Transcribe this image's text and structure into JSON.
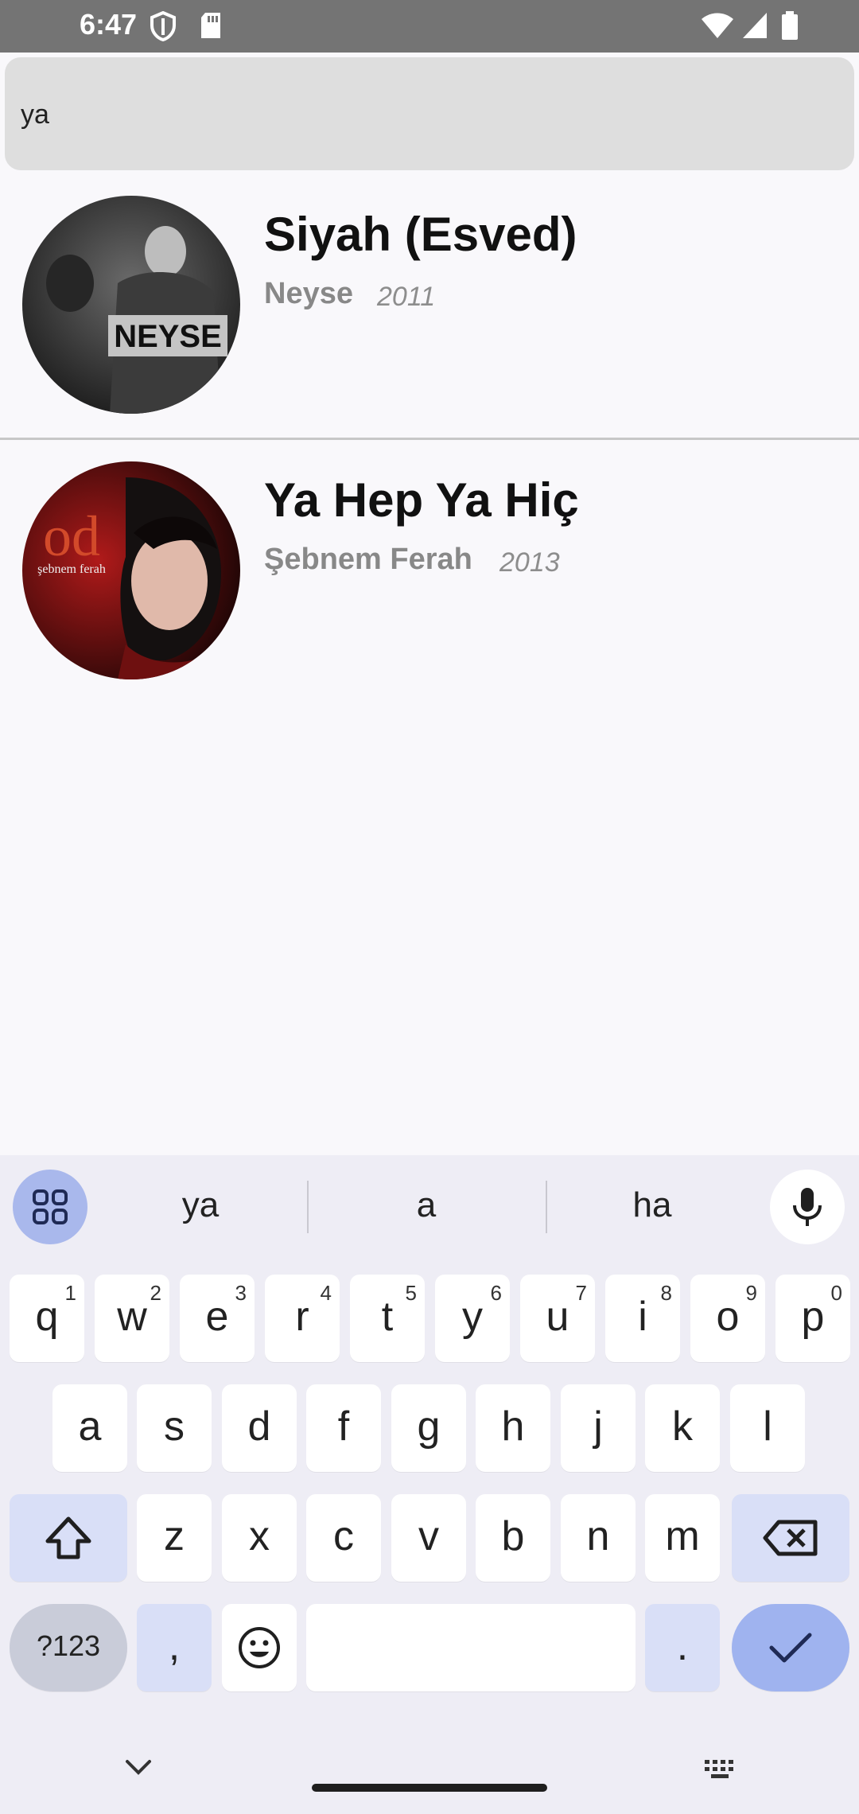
{
  "status_bar": {
    "time": "6:47"
  },
  "search": {
    "value": "ya"
  },
  "results": [
    {
      "title": "Siyah (Esved)",
      "artist": "Neyse",
      "year": "2011",
      "art_text": "NEYSE"
    },
    {
      "title": "Ya Hep Ya Hiç",
      "artist": "Şebnem Ferah",
      "year": "2013",
      "art_text": "od",
      "art_subtext": "şebnem ferah"
    }
  ],
  "keyboard": {
    "suggestions": [
      "ya",
      "a",
      "ha"
    ],
    "row1": [
      {
        "k": "q",
        "h": "1"
      },
      {
        "k": "w",
        "h": "2"
      },
      {
        "k": "e",
        "h": "3"
      },
      {
        "k": "r",
        "h": "4"
      },
      {
        "k": "t",
        "h": "5"
      },
      {
        "k": "y",
        "h": "6"
      },
      {
        "k": "u",
        "h": "7"
      },
      {
        "k": "i",
        "h": "8"
      },
      {
        "k": "o",
        "h": "9"
      },
      {
        "k": "p",
        "h": "0"
      }
    ],
    "row2": [
      "a",
      "s",
      "d",
      "f",
      "g",
      "h",
      "j",
      "k",
      "l"
    ],
    "row3": [
      "z",
      "x",
      "c",
      "v",
      "b",
      "n",
      "m"
    ],
    "symbols_label": "?123",
    "comma": ",",
    "period": "."
  }
}
